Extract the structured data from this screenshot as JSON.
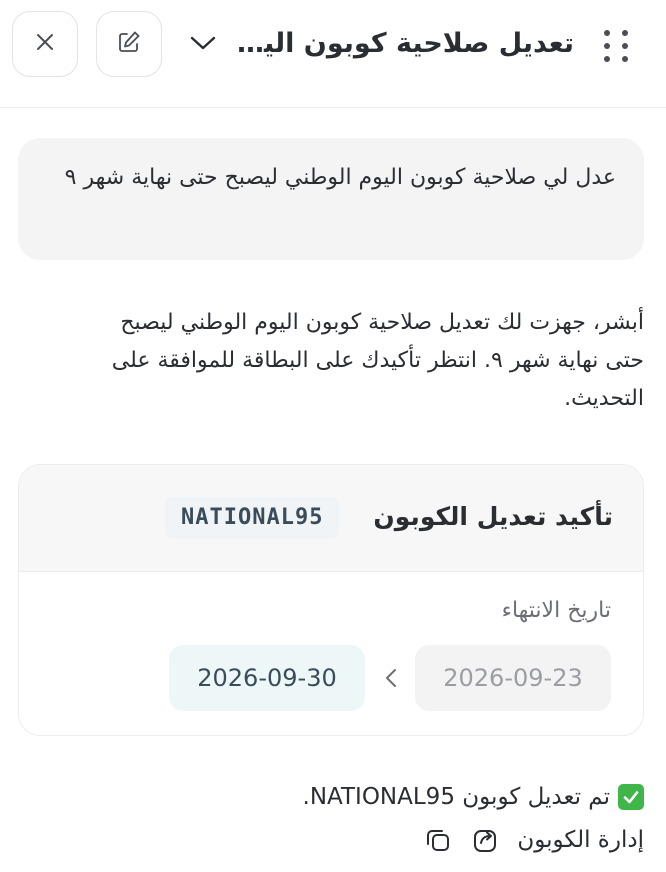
{
  "header": {
    "title": "تعديل صلاحية كوبون اليوم الوطني",
    "icons": {
      "close": "close-icon",
      "edit": "edit-icon",
      "chevron": "chevron-down-icon",
      "drag": "drag-handle-icon"
    }
  },
  "messages": {
    "user_text": "عدل لي صلاحية كوبون اليوم الوطني ليصبح حتى نهاية شهر ٩",
    "assistant_text": "أبشر، جهزت لك تعديل صلاحية كوبون اليوم الوطني ليصبح حتى نهاية شهر ٩. انتظر تأكيدك على البطاقة للموافقة على التحديث."
  },
  "card": {
    "title": "تأكيد تعديل الكوبون",
    "code": "NATIONAL95",
    "expiry_label": "تاريخ الانتهاء",
    "old_date": "2026-09-23",
    "new_date": "2026-09-30"
  },
  "result": {
    "check_icon": "check-icon",
    "text": "تم تعديل كوبون NATIONAL95.",
    "manage_link": "إدارة الكوبون",
    "icons": {
      "share": "share-icon",
      "copy": "copy-icon"
    }
  },
  "colors": {
    "check": "#3fb54a",
    "new_date_bg": "#eef7f7",
    "code_text": "#3a4c5a"
  }
}
